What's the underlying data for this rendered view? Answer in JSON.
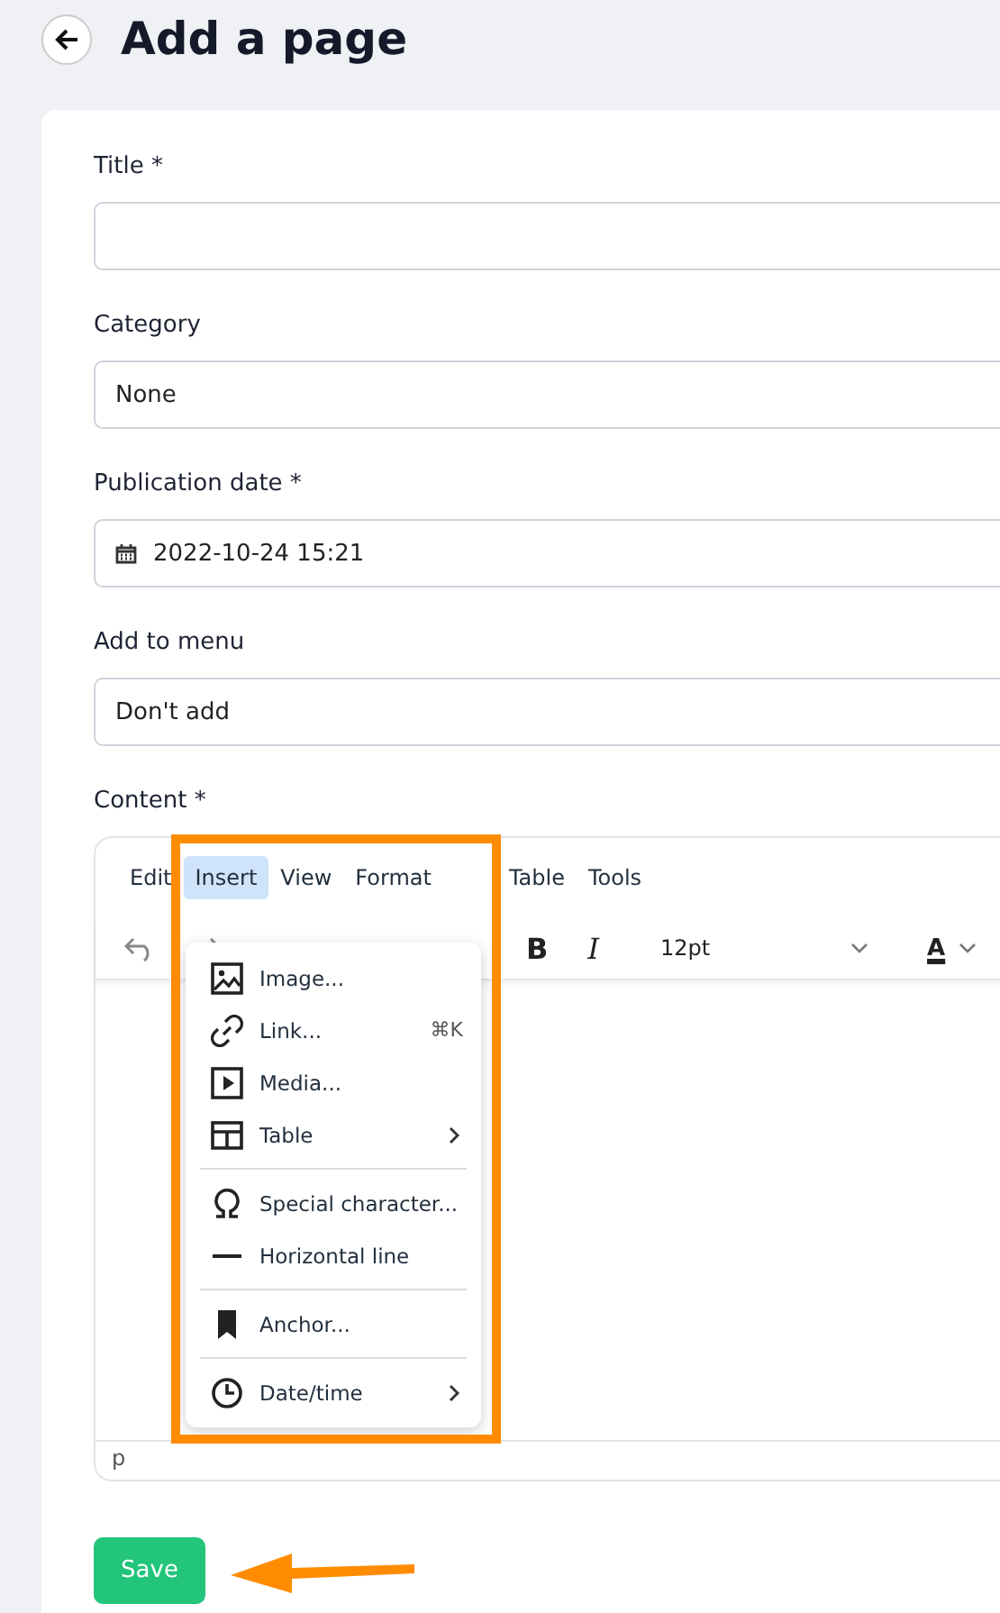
{
  "header": {
    "title": "Add a page"
  },
  "fields": [
    {
      "label": "Title *",
      "kind": "text"
    },
    {
      "label": "Category",
      "kind": "select",
      "value": "None"
    },
    {
      "label": "Publication date *",
      "kind": "date",
      "value": "2022-10-24 15:21"
    },
    {
      "label": "Add to menu",
      "kind": "select",
      "value": "Don't add"
    }
  ],
  "editor": {
    "label": "Content *",
    "menubar": [
      {
        "label": "Edit",
        "selected": false
      },
      {
        "label": "Insert",
        "selected": true
      },
      {
        "label": "View",
        "selected": false
      },
      {
        "label": "Format",
        "selected": false
      },
      {
        "label": "Table",
        "selected": false
      },
      {
        "label": "Tools",
        "selected": false
      }
    ],
    "toolbar": {
      "bold": "B",
      "italic": "I",
      "font_size": "12pt",
      "text_color": "A"
    },
    "menu": {
      "groups": [
        [
          {
            "label": "Image...",
            "submenu": false
          },
          {
            "label": "Link...",
            "shortcut": "⌘K",
            "submenu": false
          },
          {
            "label": "Media...",
            "submenu": false
          },
          {
            "label": "Table",
            "submenu": true
          }
        ],
        [
          {
            "label": "Special character...",
            "submenu": false
          },
          {
            "label": "Horizontal line",
            "submenu": false
          }
        ],
        [
          {
            "label": "Anchor...",
            "submenu": false
          }
        ],
        [
          {
            "label": "Date/time",
            "submenu": true
          }
        ]
      ]
    },
    "status": "p"
  },
  "save_button": "Save"
}
